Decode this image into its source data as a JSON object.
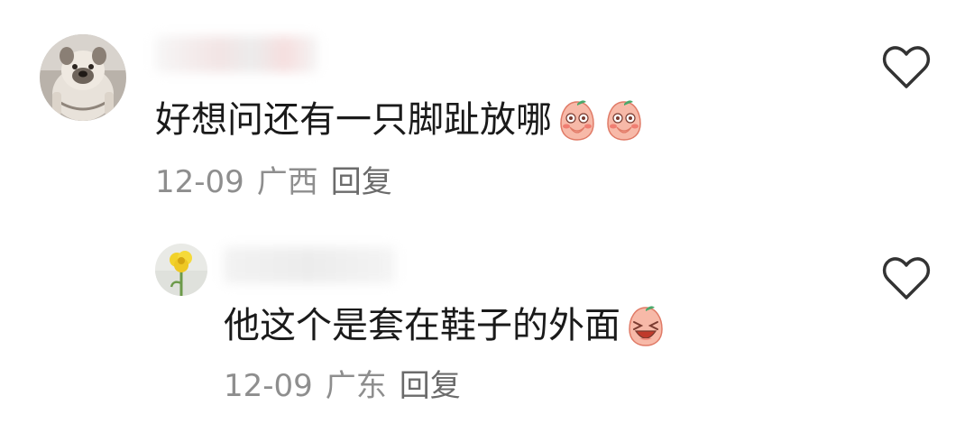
{
  "comments": [
    {
      "text": "好想问还有一只脚趾放哪",
      "emojis": [
        "peach-cover-mouth-emoji",
        "peach-cover-mouth-emoji"
      ],
      "date": "12-09",
      "location": "广西",
      "reply_label": "回复",
      "avatar": "bulldog-avatar"
    },
    {
      "text": "他这个是套在鞋子的外面",
      "emojis": [
        "peach-laughing-emoji"
      ],
      "date": "12-09",
      "location": "广东",
      "reply_label": "回复",
      "avatar": "yellow-flower-avatar"
    }
  ],
  "icons": {
    "like": "heart-outline-icon"
  },
  "colors": {
    "text": "#1a1a1a",
    "meta": "#8e8e8e",
    "reply": "#6b6b6b",
    "peach": "#f7b9a8"
  }
}
